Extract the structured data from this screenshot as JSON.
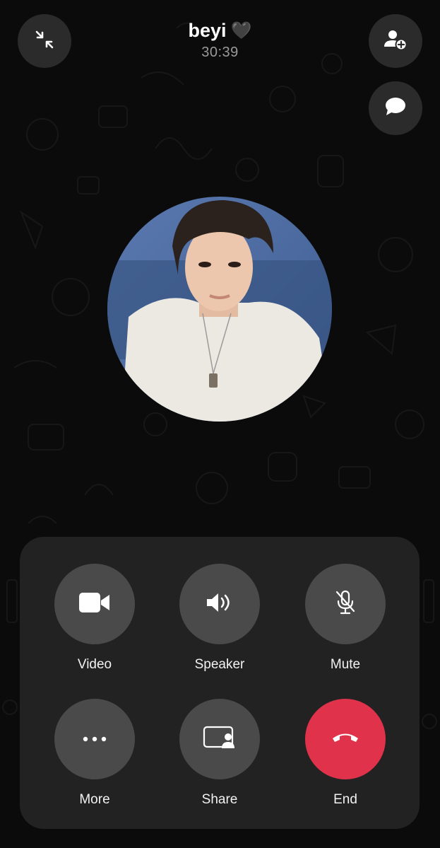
{
  "call": {
    "contact_name": "beyi",
    "heart_emoji": "🖤",
    "duration": "30:39"
  },
  "top_buttons": [
    {
      "icon": "minimize-icon"
    },
    {
      "icon": "add-person-icon"
    },
    {
      "icon": "chat-bubble-icon"
    }
  ],
  "controls": [
    {
      "label": "Video",
      "icon": "video-camera-icon"
    },
    {
      "label": "Speaker",
      "icon": "speaker-icon"
    },
    {
      "label": "Mute",
      "icon": "microphone-muted-icon"
    },
    {
      "label": "More",
      "icon": "more-dots-icon"
    },
    {
      "label": "Share",
      "icon": "screen-share-icon"
    },
    {
      "label": "End",
      "icon": "end-call-icon"
    }
  ],
  "colors": {
    "background": "#0b0b0b",
    "panel": "#222222",
    "button": "#4a4a4a",
    "end_button": "#e0334b",
    "timer": "#9a9a9a"
  }
}
